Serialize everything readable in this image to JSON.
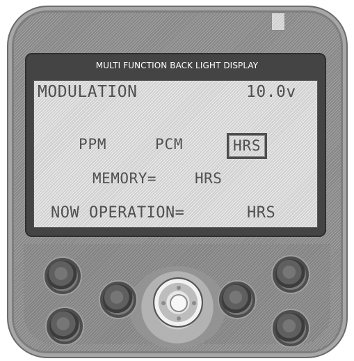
{
  "header": {
    "title": "MULTI FUNCTION BACK LIGHT DISPLAY"
  },
  "lcd": {
    "modulation_label": "MODULATION",
    "voltage": "10.0v",
    "modes": [
      "PPM",
      "PCM",
      "HRS"
    ],
    "selected_mode": "HRS",
    "memory_label": "MEMORY=",
    "memory_value": "HRS",
    "now_operation_label": "NOW OPERATION=",
    "now_operation_value": "HRS"
  },
  "controls": {
    "center_pad_icon": "four-way-dpad-icon"
  },
  "colors": {
    "body": "#8f8f8f",
    "bezel": "#444444",
    "screen": "#dcdcdc",
    "screen_text": "#505050"
  }
}
